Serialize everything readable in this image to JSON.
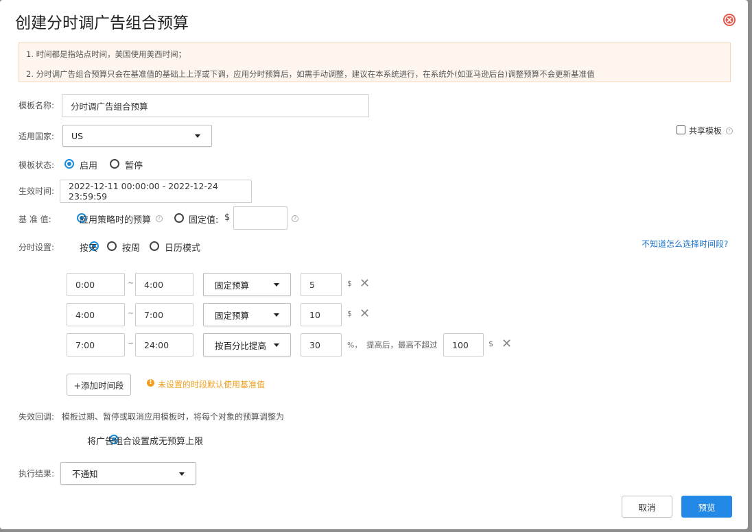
{
  "dialog": {
    "title": "创建分时调广告组合预算",
    "close_icon": "close-circle-icon"
  },
  "notice": {
    "line1": "1. 时间都是指站点时间，美国使用美西时间；",
    "line2": "2. 分时调广告组合预算只会在基准值的基础上上浮或下调，应用分时预算后，如需手动调整，建议在本系统进行，在系统外(如亚马逊后台)调整预算不会更新基准值"
  },
  "form": {
    "template_name": {
      "label": "模板名称:",
      "value": "分时调广告组合预算"
    },
    "country": {
      "label": "适用国家:",
      "value": "US"
    },
    "share": {
      "label": "共享模板",
      "checked": false
    },
    "status": {
      "label": "模板状态:",
      "options": [
        "启用",
        "暂停"
      ],
      "selected": "启用"
    },
    "effective_time": {
      "label": "生效时间:",
      "value": "2022-12-11 00:00:00 - 2022-12-24 23:59:59"
    },
    "baseline": {
      "label": "基 准 值:",
      "option_strategy": "应用策略时的预算",
      "option_fixed": "固定值:",
      "currency": "$",
      "fixed_value": "",
      "selected": "应用策略时的预算"
    },
    "timeshare": {
      "label": "分时设置:",
      "options": [
        "按天",
        "按周",
        "日历模式"
      ],
      "selected": "按天",
      "help_link": "不知道怎么选择时间段?"
    },
    "time_rows": [
      {
        "start": "0:00",
        "end": "4:00",
        "mode": "固定预算",
        "value": "5",
        "unit": "$"
      },
      {
        "start": "4:00",
        "end": "7:00",
        "mode": "固定预算",
        "value": "10",
        "unit": "$"
      },
      {
        "start": "7:00",
        "end": "24:00",
        "mode": "按百分比提高",
        "value": "30",
        "unit": "%，",
        "cap_label": "提高后，最高不超过",
        "cap_value": "100",
        "cap_unit": "$"
      }
    ],
    "tilde": "~",
    "add_segment": "+添加时间段",
    "default_note": "未设置的时段默认使用基准值",
    "fallback": {
      "label": "失效回调:",
      "desc": "模板过期、暂停或取消应用模板时，将每个对象的预算调整为",
      "option": "将广告组合设置成无预算上限"
    },
    "result": {
      "label": "执行结果:",
      "value": "不通知"
    }
  },
  "footer": {
    "cancel": "取消",
    "preview": "预览"
  },
  "colors": {
    "primary": "#2389e6",
    "radio_active": "#1b8cd8",
    "link": "#1a73c9",
    "warning": "#f0a020",
    "notice_bg": "#fef6ee",
    "close": "#e05a4e"
  }
}
